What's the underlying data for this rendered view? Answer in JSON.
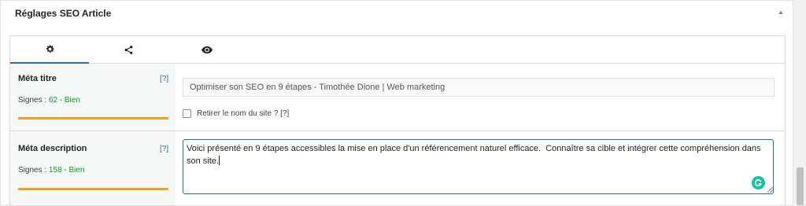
{
  "panel": {
    "title": "Réglages SEO Article",
    "toggle": "▲"
  },
  "tabs": [
    {
      "icon": "gear-icon",
      "active": true
    },
    {
      "icon": "share-icon",
      "active": false
    },
    {
      "icon": "eye-icon",
      "active": false
    }
  ],
  "meta_title": {
    "label": "Méta titre",
    "help": "[?]",
    "signs_prefix": "Signes : ",
    "signs_value": "62 - Bien",
    "value": "Optimiser son SEO en 9 étapes - Timothée Dione | Web marketing",
    "checkbox_label": "Retirer le nom du site ? [?]",
    "checkbox_checked": false
  },
  "meta_description": {
    "label": "Méta description",
    "help": "[?]",
    "signs_prefix": "Signes : ",
    "signs_value": "158 - Bien",
    "value": "Voici présenté en 9 étapes accessibles la mise en place d'un référencement naturel efficace.  Connaître sa cible et intégrer cette compréhension dans son site."
  },
  "colors": {
    "accent": "#2271b1",
    "good": "#00a32a",
    "bar": "#f0a020",
    "grammarly": "#15c39a"
  }
}
